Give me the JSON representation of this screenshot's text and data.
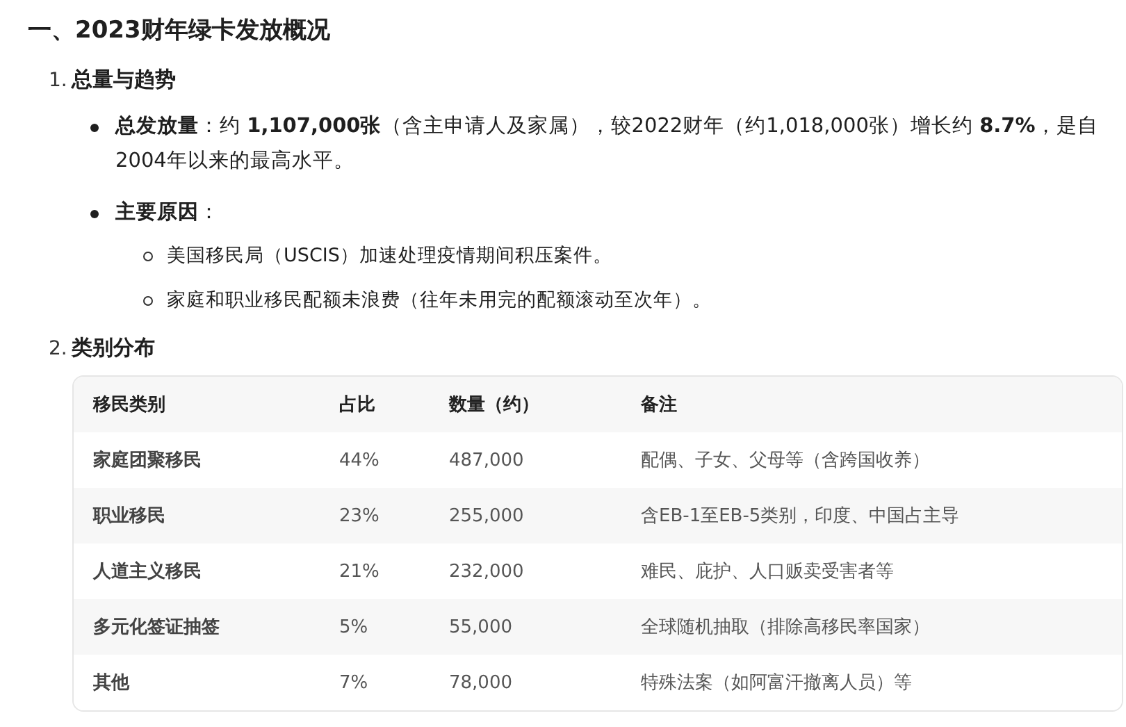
{
  "heading": "一、2023财年绿卡发放概况",
  "sections": [
    {
      "number": "1.",
      "title": "总量与趋势",
      "bullets": [
        {
          "text": "**总发放量**：约 **1,107,000张**（含主申请人及家属），较2022财年（约1,018,000张）增长约 **8.7%**，是自2004年以来的最高水平。"
        },
        {
          "text": "**主要原因**：",
          "children": [
            {
              "text": "美国移民局（USCIS）加速处理疫情期间积压案件。"
            },
            {
              "text": "家庭和职业移民配额未浪费（往年未用完的配额滚动至次年）。"
            }
          ]
        }
      ]
    },
    {
      "number": "2.",
      "title": "类别分布",
      "table": {
        "columns": [
          "移民类别",
          "占比",
          "数量（约）",
          "备注"
        ],
        "rows": [
          [
            "家庭团聚移民",
            "44%",
            "487,000",
            "配偶、子女、父母等（含跨国收养）"
          ],
          [
            "职业移民",
            "23%",
            "255,000",
            "含EB-1至EB-5类别，印度、中国占主导"
          ],
          [
            "人道主义移民",
            "21%",
            "232,000",
            "难民、庇护、人口贩卖受害者等"
          ],
          [
            "多元化签证抽签",
            "5%",
            "55,000",
            "全球随机抽取（排除高移民率国家）"
          ],
          [
            "其他",
            "7%",
            "78,000",
            "特殊法案（如阿富汗撤离人员）等"
          ]
        ]
      }
    }
  ]
}
